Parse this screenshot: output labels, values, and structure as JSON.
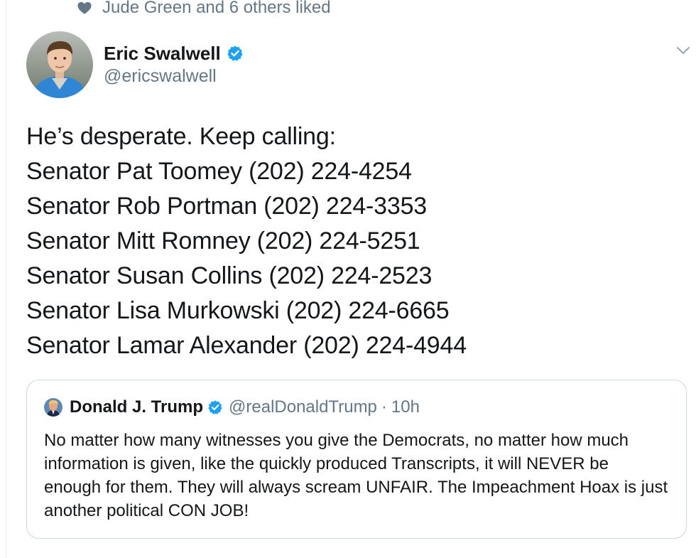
{
  "social_context": {
    "icon": "heart-icon",
    "text": "Jude Green and 6 others liked"
  },
  "tweet": {
    "author": {
      "name": "Eric Swalwell",
      "handle": "@ericswalwell",
      "verified": true
    },
    "lines": [
      "He’s desperate. Keep calling:",
      "Senator Pat Toomey (202) 224-4254",
      "Senator Rob Portman (202) 224-3353",
      "Senator Mitt Romney (202) 224-5251",
      "Senator Susan Collins (202) 224-2523",
      "Senator Lisa Murkowski (202) 224-6665",
      "Senator Lamar Alexander (202) 224-4944"
    ]
  },
  "quoted_tweet": {
    "author": {
      "name": "Donald J. Trump",
      "handle": "@realDonaldTrump",
      "verified": true
    },
    "separator": "·",
    "time": "10h",
    "text": "No matter how many witnesses you give the Democrats, no matter how much information is given, like the quickly produced Transcripts, it will NEVER be enough for them. They will always scream UNFAIR. The Impeachment Hoax is just another political CON JOB!"
  },
  "colors": {
    "text_primary": "#14171a",
    "text_secondary": "#657786",
    "verified_blue": "#1da1f2",
    "border": "#ccd6dd"
  }
}
